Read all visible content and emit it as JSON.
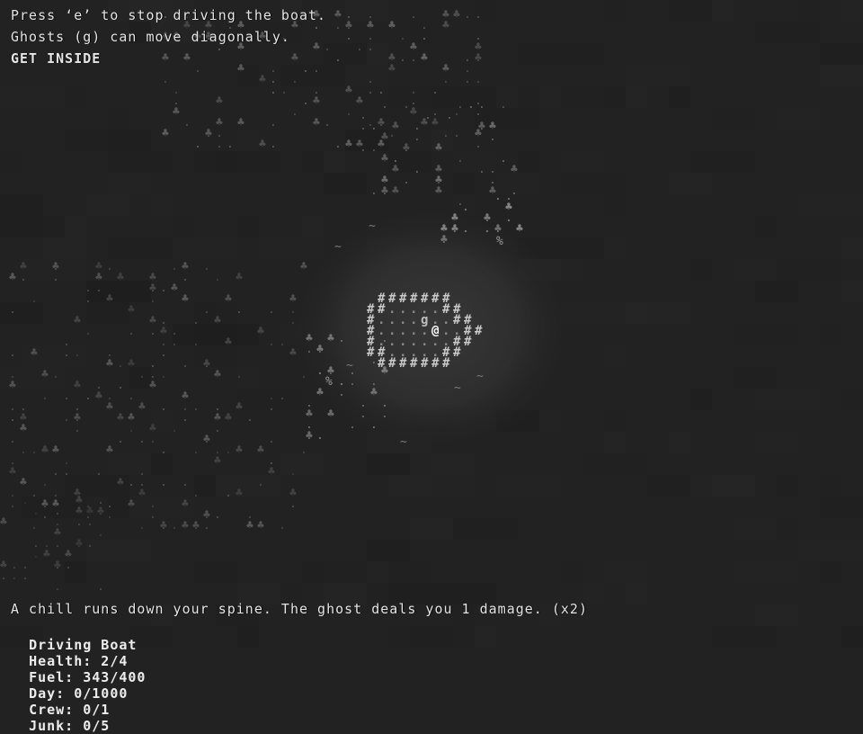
{
  "messages": {
    "hint_line_1": "Press ‘e’ to stop driving the boat.",
    "hint_line_2": "Ghosts (g) can move diagonally.",
    "objective": "GET INSIDE",
    "combat_log": "A chill runs down your spine. The ghost deals you 1 damage. (x2)"
  },
  "status": {
    "mode": "Driving Boat",
    "health": "Health: 2/4",
    "fuel": "Fuel: 343/400",
    "day": "Day: 0/1000",
    "crew": "Crew: 0/1",
    "junk": "Junk: 0/5"
  },
  "glyphs": {
    "player": "@",
    "ghost": "g",
    "wall": "#",
    "floor": ".",
    "tree": "♣",
    "wave": "~",
    "junk": "%"
  },
  "colors": {
    "background": "#222222",
    "lit_area": "#333333",
    "boat": "#c8c8c8",
    "terrain": "#6a6a6a"
  }
}
